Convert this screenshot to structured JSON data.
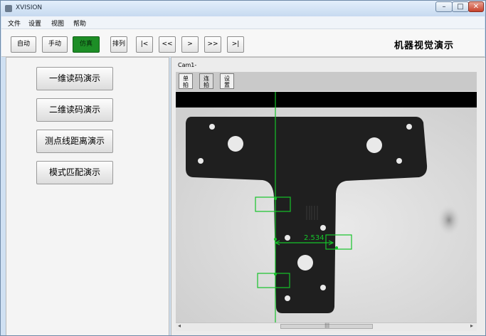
{
  "window": {
    "title": "XVISION"
  },
  "menu": [
    "文件",
    "设置",
    "视图",
    "帮助"
  ],
  "toolbar": {
    "buttons": [
      "自动",
      "手动",
      "仿真",
      "排列"
    ],
    "active_button": "仿真",
    "nav": [
      "|<",
      "<<",
      ">",
      ">>",
      ">|"
    ],
    "brand": "机器视觉演示"
  },
  "demos": [
    "一维读码演示",
    "二维读码演示",
    "测点线距离演示",
    "模式匹配演示"
  ],
  "camera": {
    "title": "Cam1-",
    "buttons": [
      {
        "top": "单",
        "bottom": "拍"
      },
      {
        "top": "连",
        "bottom": "拍"
      },
      {
        "top": "设",
        "bottom": "置"
      }
    ],
    "measurement": "2.534"
  },
  "scrollbar": {
    "left": "◂",
    "right": "▸",
    "grip": "|||"
  },
  "colors": {
    "accent": "#1d8e26",
    "overlay": "#16c32a",
    "panel_bg": "#cfe0f2"
  }
}
